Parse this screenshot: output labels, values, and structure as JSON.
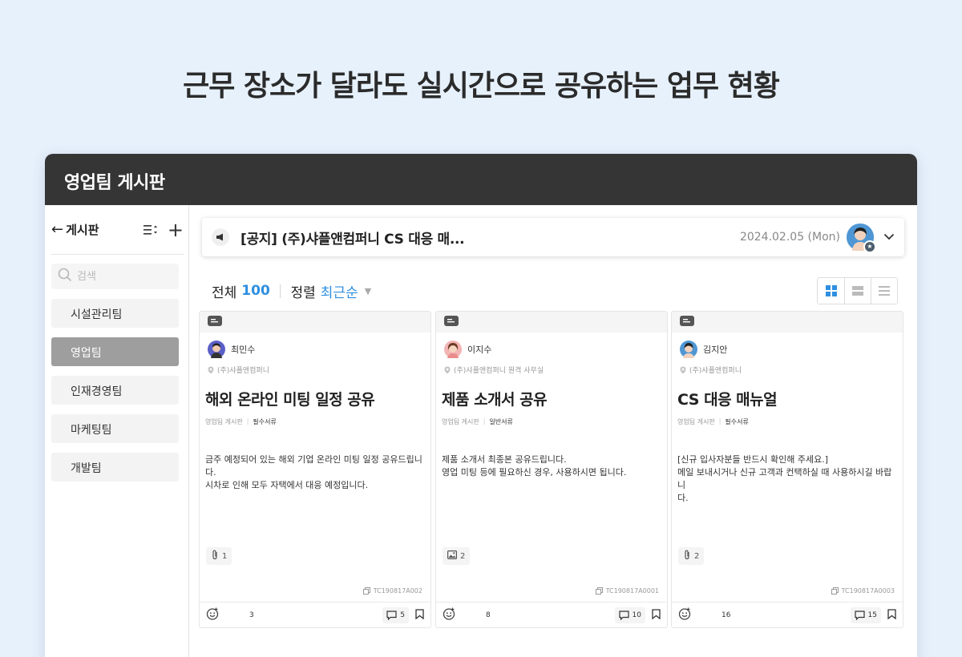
{
  "headline": "근무 장소가 달라도 실시간으로 공유하는 업무 현황",
  "window_title": "영업팀 게시판",
  "sidebar": {
    "back_label": "게시판",
    "search_placeholder": "검색",
    "teams": [
      {
        "label": "시설관리팀",
        "active": false
      },
      {
        "label": "영업팀",
        "active": true
      },
      {
        "label": "인재경영팀",
        "active": false
      },
      {
        "label": "마케팅팀",
        "active": false
      },
      {
        "label": "개발팀",
        "active": false
      }
    ]
  },
  "notice": {
    "title": "[공지] (주)샤플앤컴퍼니 CS 대응 매...",
    "date": "2024.02.05 (Mon)"
  },
  "list": {
    "total_label": "전체",
    "total_count": "100",
    "sort_label": "정렬",
    "sort_value": "최근순"
  },
  "posts": [
    {
      "author": "최민수",
      "location": "(주)샤플앤컴퍼니",
      "title": "해외 온라인 미팅 일정 공유",
      "board": "영업팀 게시판",
      "category": "필수서류",
      "body_lines": [
        "금주 예정되어 있는 해외 기업 온라인 미팅 일정 공유드립니다.",
        "시차로 인해 모두 자택에서 대응 예정입니다."
      ],
      "attach_type": "clip",
      "attach_count": "1",
      "code": "TC190817A002",
      "reactions": "3",
      "comments": "5"
    },
    {
      "author": "이지수",
      "location": "(주)샤플앤컴퍼니 원격 사무실",
      "title": "제품 소개서 공유",
      "board": "영업팀 게시판",
      "category": "일반서류",
      "body_lines": [
        "제품 소개서 최종본 공유드립니다.",
        "영업 미팅 등에 필요하신 경우, 사용하시면 됩니다."
      ],
      "attach_type": "image",
      "attach_count": "2",
      "code": "TC190817A0001",
      "reactions": "8",
      "comments": "10"
    },
    {
      "author": "김지안",
      "location": "(주)샤플앤컴퍼니",
      "title": "CS 대응 매뉴얼",
      "board": "영업팀 게시판",
      "category": "필수서류",
      "body_lines": [
        "[신규 입사자분들 반드시 확인해 주세요.]",
        "메일 보내시거나 신규 고객과 컨택하실 때 사용하시길 바랍니",
        "다."
      ],
      "attach_type": "clip",
      "attach_count": "2",
      "code": "TC190817A0003",
      "reactions": "16",
      "comments": "15"
    }
  ],
  "colors": {
    "accent": "#2f8fe0",
    "titlebar": "#353535",
    "page_bg": "#e7f1fc"
  }
}
